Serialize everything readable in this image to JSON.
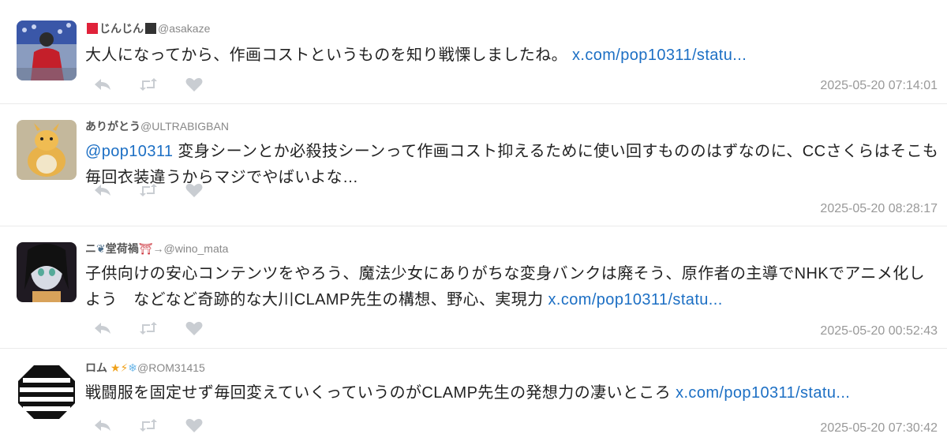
{
  "tweets": [
    {
      "name": "じんじん",
      "handle": "@asakaze",
      "name_prefix_color": "#e0223a",
      "name_suffix_color": "#333333",
      "text": "大人になってから、作画コストというものを知り戦慄しましたね。",
      "link": "x.com/pop10311/statu...",
      "timestamp": "2025-05-20 07:14:01"
    },
    {
      "name": "ありがとう",
      "handle": "@ULTRABIGBAN",
      "mention": "@pop10311",
      "text": "変身シーンとか必殺技シーンって作画コスト抑えるために使い回すもののはずなのに、CCさくらはそこも毎回衣装違うからマジでやばいよな…",
      "timestamp": "2025-05-20 08:28:17"
    },
    {
      "name_a": "ニ",
      "name_b": "堂荷禍",
      "name_c": "→",
      "handle": "@wino_mata",
      "text": "子供向けの安心コンテンツをやろう、魔法少女にありがちな変身バンクは廃そう、原作者の主導でNHKでアニメ化しよう　などなど奇跡的な大川CLAMP先生の構想、野心、実現力",
      "link": "x.com/pop10311/statu...",
      "timestamp": "2025-05-20 00:52:43"
    },
    {
      "name": "ロム",
      "handle": "@ROM31415",
      "text": "戦闘服を固定せず毎回変えていくっていうのがCLAMP先生の発想力の凄いところ",
      "link": "x.com/pop10311/statu...",
      "timestamp": "2025-05-20 07:30:42"
    }
  ],
  "icons": {
    "reply": "reply-icon",
    "retweet": "retweet-icon",
    "like": "heart-icon",
    "star": "★",
    "bolt": "⚡",
    "snow": "❄",
    "torii": "⛩"
  },
  "colors": {
    "link": "#1c6fc4",
    "muted": "#999999",
    "action": "#c9cdd2"
  }
}
